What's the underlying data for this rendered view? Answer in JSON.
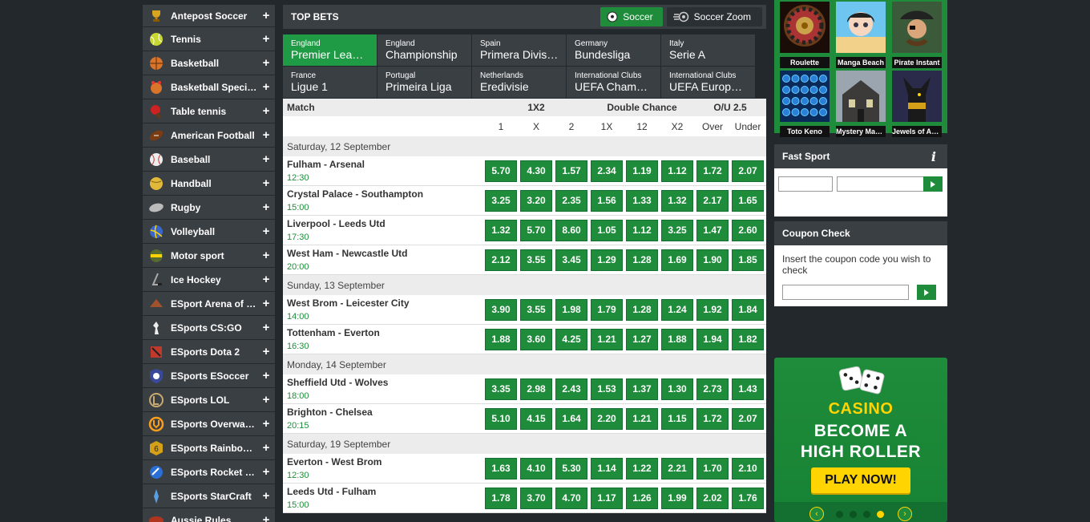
{
  "sidebar": {
    "items": [
      {
        "label": "Antepost Soccer",
        "icon": "trophy-icon"
      },
      {
        "label": "Tennis",
        "icon": "tennis-ball-icon"
      },
      {
        "label": "Basketball",
        "icon": "basketball-icon"
      },
      {
        "label": "Basketball Specials",
        "icon": "basketball-specials-icon"
      },
      {
        "label": "Table tennis",
        "icon": "table-tennis-icon"
      },
      {
        "label": "American Football",
        "icon": "american-football-icon"
      },
      {
        "label": "Baseball",
        "icon": "baseball-icon"
      },
      {
        "label": "Handball",
        "icon": "handball-icon"
      },
      {
        "label": "Rugby",
        "icon": "rugby-ball-icon"
      },
      {
        "label": "Volleyball",
        "icon": "volleyball-icon"
      },
      {
        "label": "Motor sport",
        "icon": "motor-sport-icon"
      },
      {
        "label": "Ice Hockey",
        "icon": "ice-hockey-icon"
      },
      {
        "label": "ESport Arena of Valor",
        "icon": "arena-of-valor-icon"
      },
      {
        "label": "ESports CS:GO",
        "icon": "csgo-icon"
      },
      {
        "label": "ESports Dota 2",
        "icon": "dota2-icon"
      },
      {
        "label": "ESports ESoccer",
        "icon": "esoccer-icon"
      },
      {
        "label": "ESports LOL",
        "icon": "lol-icon"
      },
      {
        "label": "ESports Overwatch",
        "icon": "overwatch-icon"
      },
      {
        "label": "ESports Rainbow Six",
        "icon": "rainbow-six-icon"
      },
      {
        "label": "ESports Rocket League",
        "icon": "rocket-league-icon"
      },
      {
        "label": "ESports StarCraft",
        "icon": "starcraft-icon"
      },
      {
        "label": "Aussie Rules",
        "icon": "aussie-rules-icon"
      }
    ],
    "plus": "+"
  },
  "top_bets": {
    "title": "TOP BETS",
    "soccer_button": "Soccer",
    "zoom_button": "Soccer Zoom",
    "leagues": [
      {
        "country": "England",
        "name": "Premier League",
        "active": true
      },
      {
        "country": "England",
        "name": "Championship"
      },
      {
        "country": "Spain",
        "name": "Primera Division"
      },
      {
        "country": "Germany",
        "name": "Bundesliga"
      },
      {
        "country": "Italy",
        "name": "Serie A"
      },
      {
        "country": "France",
        "name": "Ligue 1"
      },
      {
        "country": "Portugal",
        "name": "Primeira Liga"
      },
      {
        "country": "Netherlands",
        "name": "Eredivisie"
      },
      {
        "country": "International Clubs",
        "name": "UEFA Champions League"
      },
      {
        "country": "International Clubs",
        "name": "UEFA Europa League"
      }
    ]
  },
  "table": {
    "match_header": "Match",
    "group_1x2": "1X2",
    "group_dc": "Double Chance",
    "group_ou": "O/U 2.5",
    "subheaders": [
      "1",
      "X",
      "2",
      "1X",
      "12",
      "X2",
      "Over",
      "Under"
    ],
    "days": [
      {
        "date": "Saturday, 12 September",
        "matches": [
          {
            "name": "Fulham - Arsenal",
            "time": "12:30",
            "odds": [
              "5.70",
              "4.30",
              "1.57",
              "2.34",
              "1.19",
              "1.12",
              "1.72",
              "2.07"
            ]
          },
          {
            "name": "Crystal Palace - Southampton",
            "time": "15:00",
            "odds": [
              "3.25",
              "3.20",
              "2.35",
              "1.56",
              "1.33",
              "1.32",
              "2.17",
              "1.65"
            ]
          },
          {
            "name": "Liverpool - Leeds Utd",
            "time": "17:30",
            "odds": [
              "1.32",
              "5.70",
              "8.60",
              "1.05",
              "1.12",
              "3.25",
              "1.47",
              "2.60"
            ]
          },
          {
            "name": "West Ham - Newcastle Utd",
            "time": "20:00",
            "odds": [
              "2.12",
              "3.55",
              "3.45",
              "1.29",
              "1.28",
              "1.69",
              "1.90",
              "1.85"
            ]
          }
        ]
      },
      {
        "date": "Sunday, 13 September",
        "matches": [
          {
            "name": "West Brom - Leicester City",
            "time": "14:00",
            "odds": [
              "3.90",
              "3.55",
              "1.98",
              "1.79",
              "1.28",
              "1.24",
              "1.92",
              "1.84"
            ]
          },
          {
            "name": "Tottenham - Everton",
            "time": "16:30",
            "odds": [
              "1.88",
              "3.60",
              "4.25",
              "1.21",
              "1.27",
              "1.88",
              "1.94",
              "1.82"
            ]
          }
        ]
      },
      {
        "date": "Monday, 14 September",
        "matches": [
          {
            "name": "Sheffield Utd - Wolves",
            "time": "18:00",
            "odds": [
              "3.35",
              "2.98",
              "2.43",
              "1.53",
              "1.37",
              "1.30",
              "2.73",
              "1.43"
            ]
          },
          {
            "name": "Brighton - Chelsea",
            "time": "20:15",
            "odds": [
              "5.10",
              "4.15",
              "1.64",
              "2.20",
              "1.21",
              "1.15",
              "1.72",
              "2.07"
            ]
          }
        ]
      },
      {
        "date": "Saturday, 19 September",
        "matches": [
          {
            "name": "Everton - West Brom",
            "time": "12:30",
            "odds": [
              "1.63",
              "4.10",
              "5.30",
              "1.14",
              "1.22",
              "2.21",
              "1.70",
              "2.10"
            ]
          },
          {
            "name": "Leeds Utd - Fulham",
            "time": "15:00",
            "odds": [
              "1.78",
              "3.70",
              "4.70",
              "1.17",
              "1.26",
              "1.99",
              "2.02",
              "1.76"
            ]
          }
        ]
      }
    ]
  },
  "games": [
    {
      "label": "Roulette",
      "icon": "roulette-icon"
    },
    {
      "label": "Manga Beach",
      "icon": "manga-beach-icon"
    },
    {
      "label": "Pirate Instant",
      "icon": "pirate-icon"
    },
    {
      "label": "Toto Keno",
      "icon": "keno-icon"
    },
    {
      "label": "Mystery Mansion",
      "icon": "mansion-icon"
    },
    {
      "label": "Jewels of Anubis",
      "icon": "anubis-icon"
    }
  ],
  "fast_sport": {
    "title": "Fast Sport",
    "info": "i"
  },
  "coupon_check": {
    "title": "Coupon Check",
    "text": "Insert the coupon code you wish to check"
  },
  "casino_banner": {
    "word": "CASINO",
    "line2": "BECOME A",
    "line3": "HIGH ROLLER",
    "button": "PLAY NOW!",
    "dots": 4,
    "active_dot": 3
  },
  "colors": {
    "green": "#1e8c3a",
    "dark": "#23282d",
    "panel": "#3a3f44",
    "yellow": "#ffd400"
  }
}
